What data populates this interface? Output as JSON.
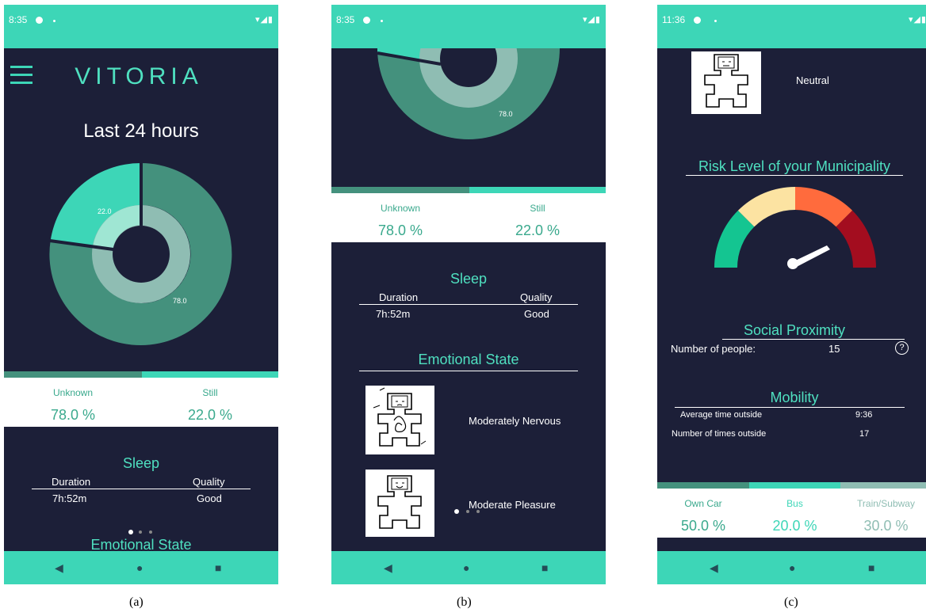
{
  "panels": {
    "a": {
      "caption": "(a)",
      "time": "8:35",
      "app_title": "VITORIA",
      "period": "Last 24 hours",
      "donut_labels": [
        "22.0",
        "78.0"
      ],
      "activities": [
        {
          "label": "Unknown",
          "value": "78.0 %"
        },
        {
          "label": "Still",
          "value": "22.0 %"
        }
      ],
      "sleep": {
        "title": "Sleep",
        "duration_label": "Duration",
        "quality_label": "Quality",
        "duration": "7h:52m",
        "quality": "Good"
      },
      "emotional_title": "Emotional State"
    },
    "b": {
      "caption": "(b)",
      "time": "8:35",
      "donut_label": "78.0",
      "activities": [
        {
          "label": "Unknown",
          "value": "78.0 %"
        },
        {
          "label": "Still",
          "value": "22.0 %"
        }
      ],
      "sleep": {
        "title": "Sleep",
        "duration_label": "Duration",
        "quality_label": "Quality",
        "duration": "7h:52m",
        "quality": "Good"
      },
      "emotional_title": "Emotional State",
      "emotions": [
        "Moderately Nervous",
        "Moderate Pleasure"
      ]
    },
    "c": {
      "caption": "(c)",
      "time": "11:36",
      "emotion": "Neutral",
      "risk_title": "Risk Level of your Municipality",
      "social_title": "Social Proximity",
      "people_label": "Number of people:",
      "people_value": "15",
      "help_icon": "?",
      "mobility_title": "Mobility",
      "avg_time_label": "Average time outside",
      "avg_time_value": "9:36",
      "times_label": "Number of times outside",
      "times_value": "17",
      "transport": [
        {
          "label": "Own Car",
          "value": "50.0 %"
        },
        {
          "label": "Bus",
          "value": "20.0 %"
        },
        {
          "label": "Train/Subway",
          "value": "30.0 %"
        }
      ]
    }
  },
  "colors": {
    "status_bar": "#3dd6b7",
    "background": "#1c1f38",
    "accent": "#4fe0c0",
    "donut_dark": "#44917d",
    "donut_light": "#3dd6b7"
  },
  "icons": {
    "back": "back-triangle-icon",
    "home": "home-circle-icon",
    "recents": "recents-square-icon",
    "menu": "hamburger-menu-icon"
  }
}
